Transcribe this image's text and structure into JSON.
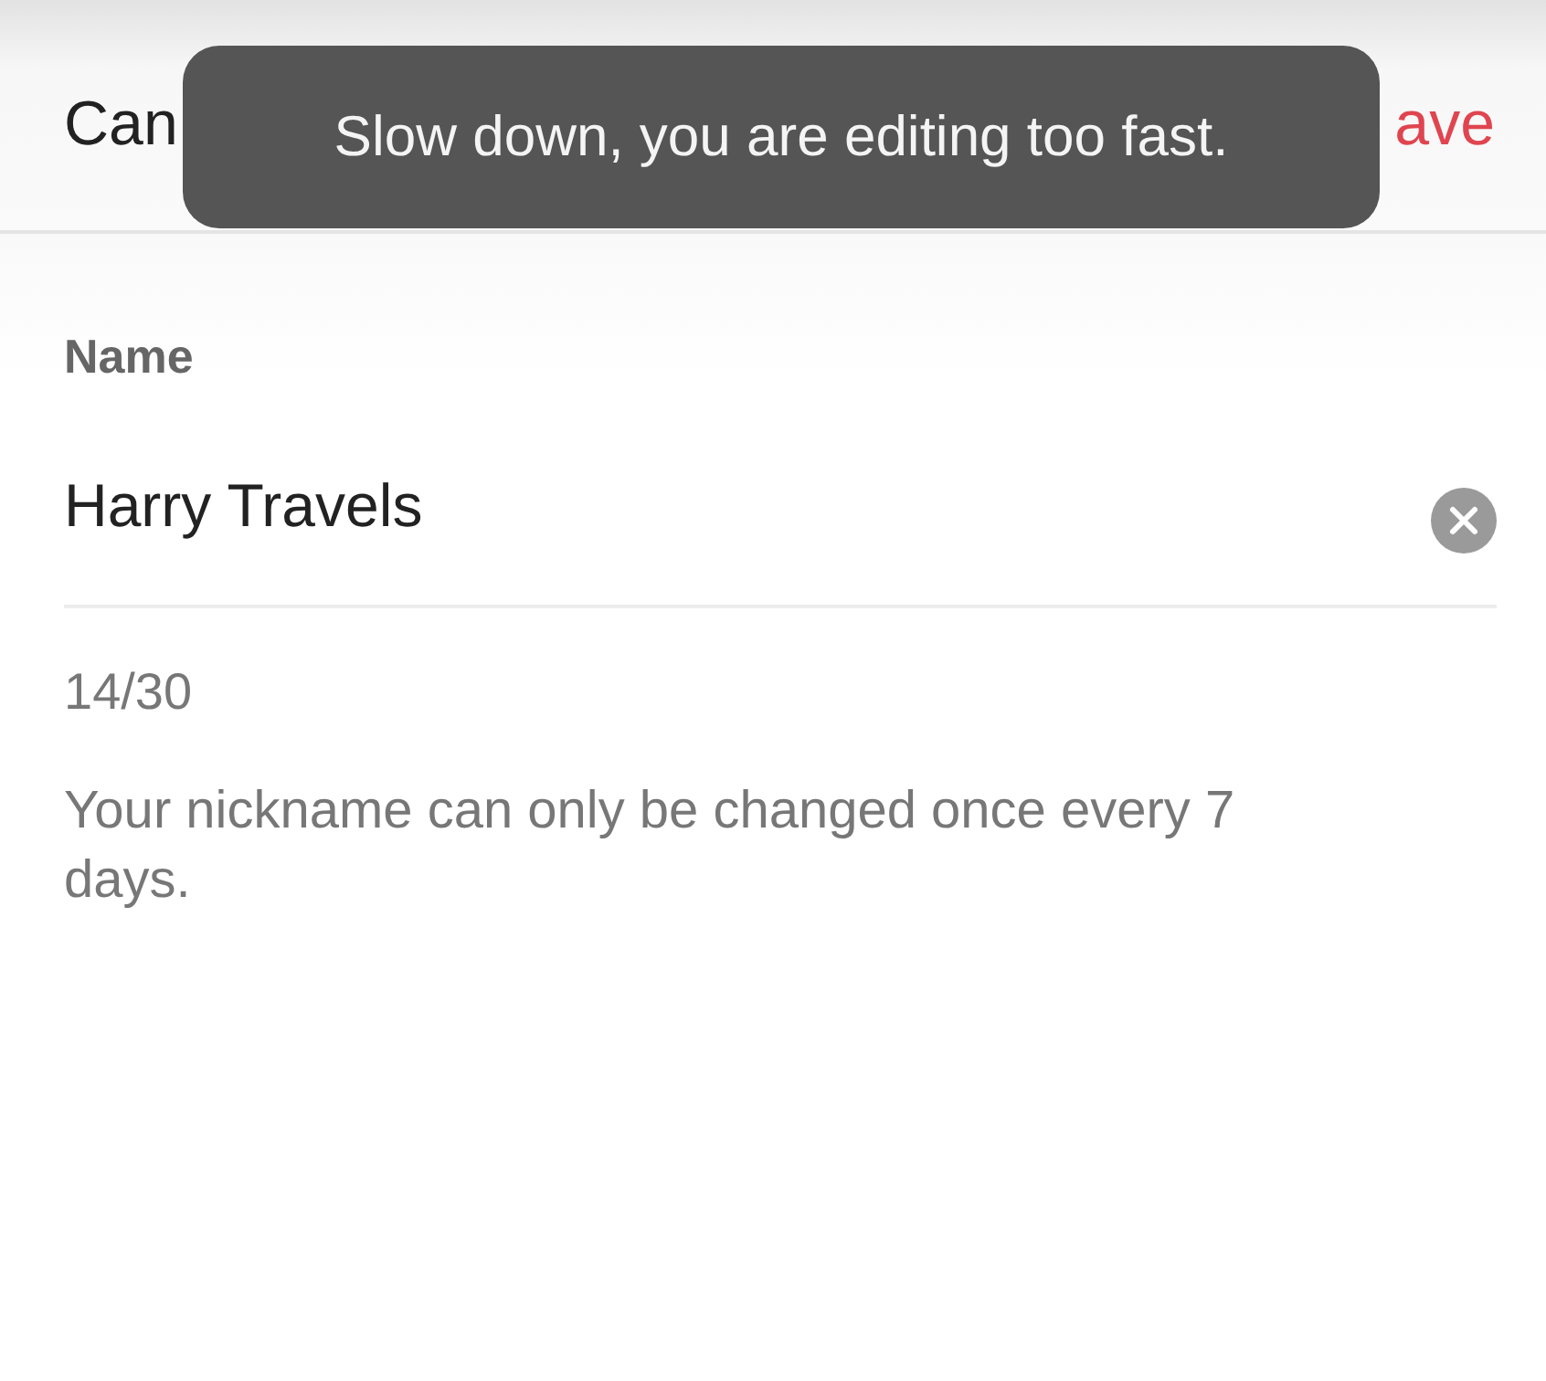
{
  "header": {
    "cancel": "Can",
    "save": "ave"
  },
  "toast": {
    "message": "Slow down, you are editing too fast."
  },
  "form": {
    "label": "Name",
    "value": "Harry Travels",
    "counter": "14/30",
    "hint": "Your nickname can only be changed once every 7 days."
  }
}
